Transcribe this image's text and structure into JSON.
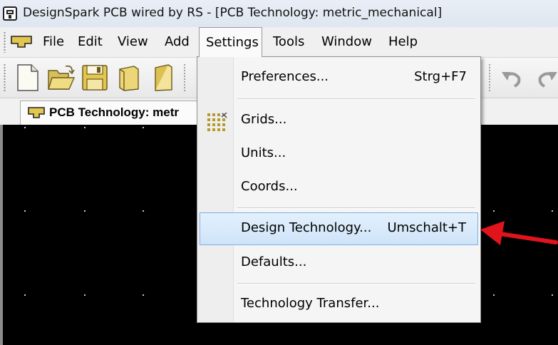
{
  "window": {
    "title": "DesignSpark PCB wired by RS - [PCB Technology: metric_mechanical]"
  },
  "menubar": {
    "items": [
      {
        "label": "File"
      },
      {
        "label": "Edit"
      },
      {
        "label": "View"
      },
      {
        "label": "Add"
      },
      {
        "label": "Settings"
      },
      {
        "label": "Tools"
      },
      {
        "label": "Window"
      },
      {
        "label": "Help"
      }
    ]
  },
  "toolbar": {
    "icons": [
      "new-document-icon",
      "open-folder-icon",
      "save-icon",
      "close-document-icon",
      "book-icon",
      "undo-icon",
      "redo-icon"
    ]
  },
  "document_tab": {
    "label": "PCB Technology: metr"
  },
  "settings_menu": {
    "items": [
      {
        "label": "Preferences...",
        "shortcut": "Strg+F7"
      },
      {
        "label": "Grids...",
        "shortcut": "",
        "icon": "grid-icon"
      },
      {
        "label": "Units...",
        "shortcut": ""
      },
      {
        "label": "Coords...",
        "shortcut": ""
      },
      {
        "label": "Design Technology...",
        "shortcut": "Umschalt+T",
        "highlighted": true
      },
      {
        "label": "Defaults...",
        "shortcut": ""
      },
      {
        "label": "Technology Transfer...",
        "shortcut": ""
      }
    ]
  },
  "colors": {
    "highlight": "#cfe4f9",
    "highlight_border": "#7ab1e6",
    "arrow": "#e0141a",
    "canvas": "#000000"
  }
}
